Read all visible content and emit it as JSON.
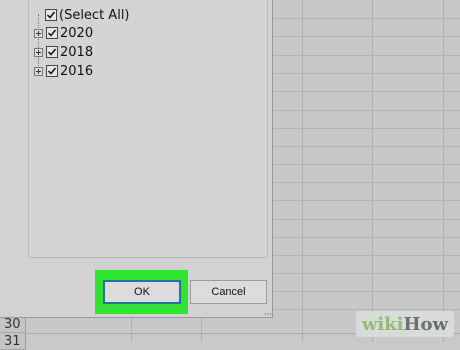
{
  "filter_tree": {
    "items": [
      {
        "label": "(Select All)",
        "checked": true,
        "expandable": false
      },
      {
        "label": "2020",
        "checked": true,
        "expandable": true
      },
      {
        "label": "2018",
        "checked": true,
        "expandable": true
      },
      {
        "label": "2016",
        "checked": true,
        "expandable": true
      }
    ]
  },
  "buttons": {
    "ok": "OK",
    "cancel": "Cancel"
  },
  "row_headers": [
    "30",
    "31"
  ],
  "watermark": {
    "wiki": "wiki",
    "how": "How"
  },
  "colors": {
    "highlight": "#2ee52e",
    "ok_border": "#2b6bb5",
    "watermark_green": "#93b874"
  }
}
